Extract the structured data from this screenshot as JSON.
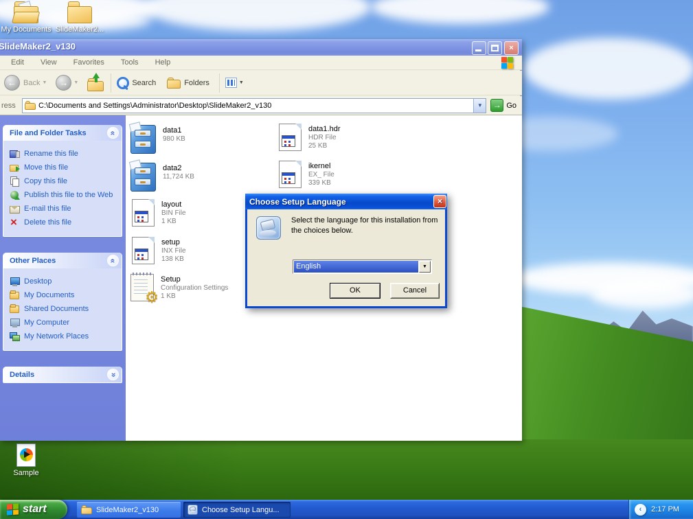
{
  "colors": {
    "active_titlebar": "#0A50D8",
    "inactive_titlebar": "#7E93E2",
    "taskbar_blue": "#2259CE",
    "start_green": "#2F8A2F",
    "taskpane_link": "#215DC6",
    "selection_blue": "#2C50C0"
  },
  "icons": {
    "desktop": [
      "my-documents-open-folder-icon",
      "folder-icon",
      "media-file-icon"
    ],
    "tasks": [
      "rename-icon",
      "move-icon",
      "copy-icon",
      "publish-globe-icon",
      "email-icon",
      "delete-x-icon"
    ],
    "toolbar": [
      "back-circle-arrow-icon",
      "forward-circle-arrow-icon",
      "up-folder-icon",
      "search-magnifier-icon",
      "folders-icon",
      "views-grid-icon"
    ],
    "dialog": [
      "installer-icon",
      "close-x-icon"
    ]
  },
  "desktop": {
    "icons": [
      {
        "label": "My Documents"
      },
      {
        "label": "SlideMaker2..."
      },
      {
        "label": "Sample"
      }
    ]
  },
  "window": {
    "title": "SlideMaker2_v130",
    "menu": [
      "Edit",
      "View",
      "Favorites",
      "Tools",
      "Help"
    ],
    "toolbar": {
      "back": "Back",
      "search": "Search",
      "folders": "Folders"
    },
    "address": {
      "label": "ress",
      "value": "C:\\Documents and Settings\\Administrator\\Desktop\\SlideMaker2_v130",
      "go": "Go"
    },
    "tasks_panel": {
      "title": "File and Folder Tasks",
      "items": [
        "Rename this file",
        "Move this file",
        "Copy this file",
        "Publish this file to the Web",
        "E-mail this file",
        "Delete this file"
      ]
    },
    "places_panel": {
      "title": "Other Places",
      "items": [
        "Desktop",
        "My Documents",
        "Shared Documents",
        "My Computer",
        "My Network Places"
      ]
    },
    "details_panel": {
      "title": "Details"
    },
    "files": [
      {
        "name": "data1",
        "meta1": "980 KB"
      },
      {
        "name": "data2",
        "meta1": "11,724 KB"
      },
      {
        "name": "layout",
        "meta1": "BIN File",
        "meta2": "1 KB"
      },
      {
        "name": "setup",
        "meta1": "INX File",
        "meta2": "138 KB"
      },
      {
        "name": "Setup",
        "meta1": "Configuration Settings",
        "meta2": "1 KB"
      },
      {
        "name": "data1.hdr",
        "meta1": "HDR File",
        "meta2": "25 KB"
      },
      {
        "name": "ikernel",
        "meta1": "EX_ File",
        "meta2": "339 KB"
      }
    ]
  },
  "dialog": {
    "title": "Choose Setup Language",
    "message": "Select the language for this installation from the choices below.",
    "combo_value": "English",
    "ok": "OK",
    "cancel": "Cancel",
    "close": "×"
  },
  "taskbar": {
    "start": "start",
    "items": [
      {
        "label": "SlideMaker2_v130"
      },
      {
        "label": "Choose Setup Langu..."
      }
    ],
    "clock": "2:17 PM"
  }
}
